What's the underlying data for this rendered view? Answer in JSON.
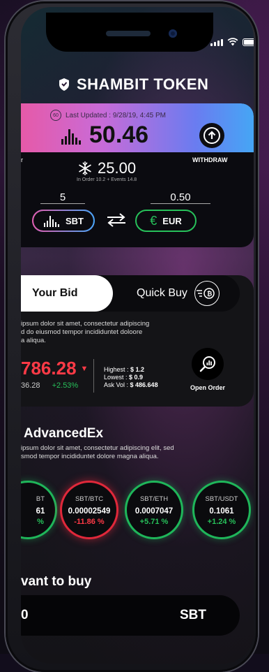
{
  "app": {
    "title": "SHAMBIT TOKEN"
  },
  "wallet": {
    "updated_badge": "60",
    "last_updated": "Last Updated : 9/28/19, 4:45 PM",
    "balance": "50.46",
    "withdraw_label": "WITHDRAW",
    "left_edge_label": "r",
    "frozen": "25.00",
    "in_order": "In Order 10.2 + Events 14.8",
    "from_qty": "5",
    "to_qty": "0.50",
    "from_currency": "SBT",
    "to_currency": "EUR",
    "euro_symbol": "€"
  },
  "bid": {
    "tab_your_bid": "Your Bid",
    "tab_quick_buy": "Quick Buy",
    "desc_lines": [
      "ipsum dolor sit amet, consectetur adipiscing",
      "d do eiusmod tempor incididuntet doloore",
      "a aliqua."
    ],
    "price": "786.28",
    "prev_price": "36.28",
    "change": "+2.53%",
    "highest_label": "Highest :",
    "highest_value": "$ 1.2",
    "lowest_label": "Lowest :",
    "lowest_value": "$ 0.9",
    "askvol_label": "Ask Vol :",
    "askvol_value": "$ 486.648",
    "open_order": "Open Order"
  },
  "advanced": {
    "title": "AdvancedEx",
    "desc_lines": [
      "ipsum dolor sit amet, consectetur adipiscing elit, sed",
      "smod tempor incididuntet dolore magna aliqua."
    ],
    "pairs": [
      {
        "name": "BT",
        "rate": "61",
        "change": "%"
      },
      {
        "name": "SBT/BTC",
        "rate": "0.00002549",
        "change": "-11.86 %"
      },
      {
        "name": "SBT/ETH",
        "rate": "0.0007047",
        "change": "+5.71 %"
      },
      {
        "name": "SBT/USDT",
        "rate": "0.1061",
        "change": "+1.24 %"
      }
    ]
  },
  "buy": {
    "heading": "vant to buy",
    "amount": "0",
    "currency": "SBT"
  },
  "colors": {
    "accent_pink": "#e65aa8",
    "accent_blue": "#45a6f5",
    "red": "#ff3a46",
    "green": "#27c15a"
  }
}
